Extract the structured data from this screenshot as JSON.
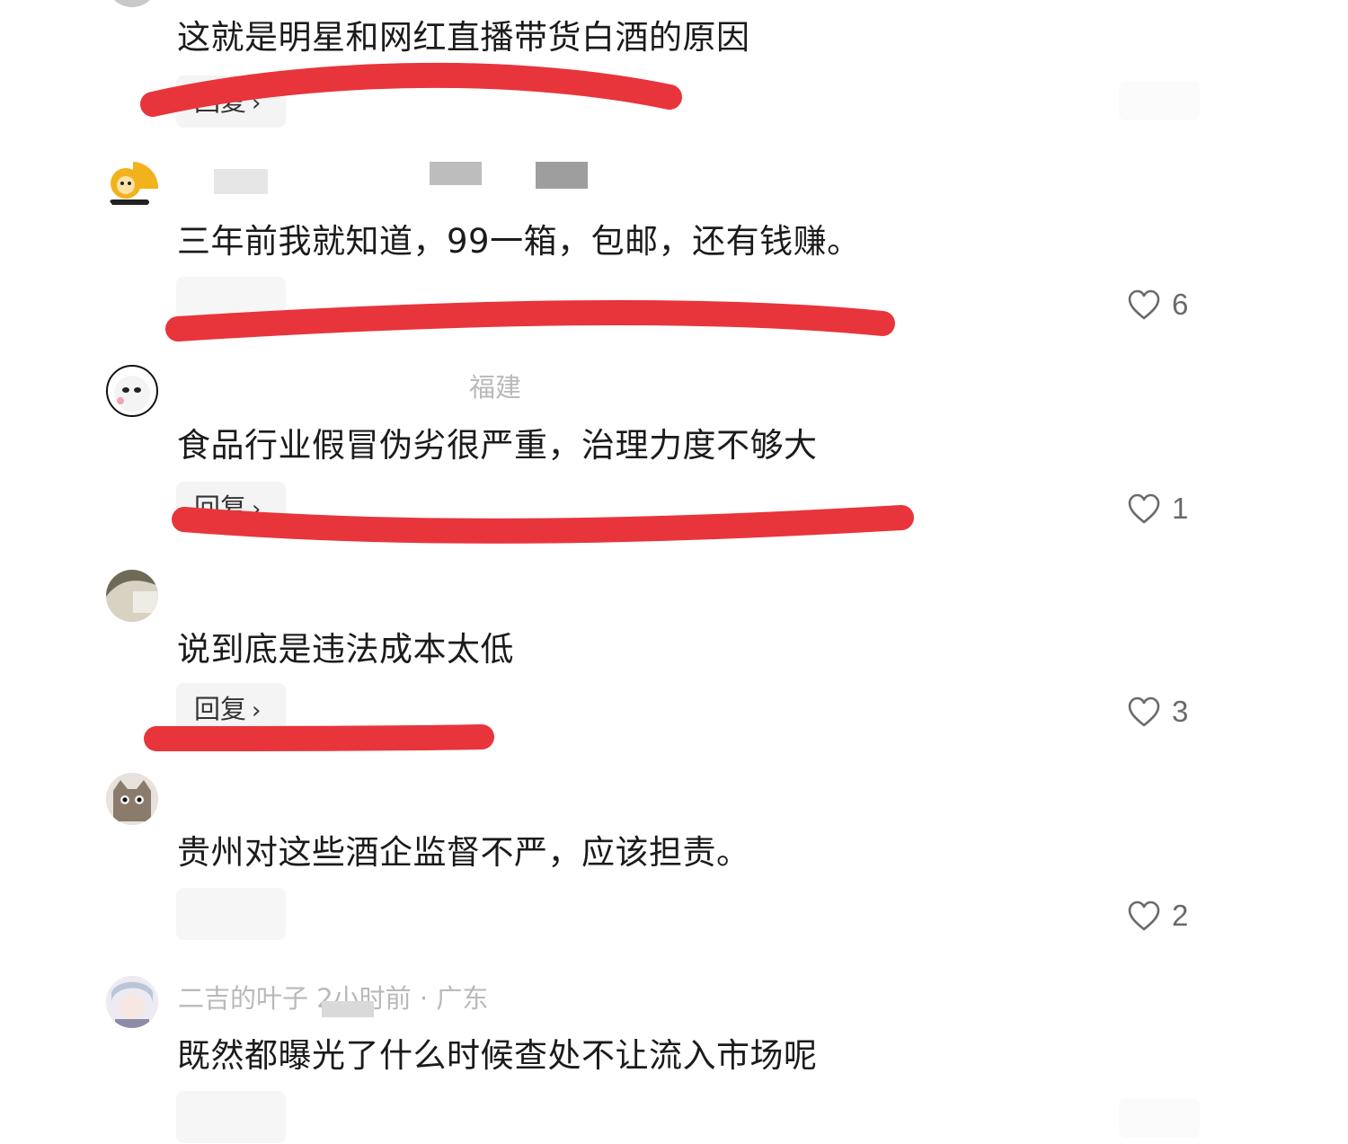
{
  "comments": [
    {
      "text": "这就是明星和网红直播带货白酒的原因",
      "reply_label": "回复",
      "reply_chevron": "›",
      "like_count": ""
    },
    {
      "text": "三年前我就知道，99一箱，包邮，还有钱赚。",
      "reply_label": "",
      "reply_chevron": "",
      "like_count": "6"
    },
    {
      "meta": "福建",
      "text": "食品行业假冒伪劣很严重，治理力度不够大",
      "reply_label": "回复",
      "reply_chevron": "›",
      "like_count": "1"
    },
    {
      "text": "说到底是违法成本太低",
      "reply_label": "回复",
      "reply_chevron": "›",
      "like_count": "3"
    },
    {
      "text": "贵州对这些酒企监督不严，应该担责。",
      "reply_label": "",
      "reply_chevron": "",
      "like_count": "2"
    },
    {
      "meta": "二吉的叶子  2小时前 · 广东",
      "text": "既然都曝光了什么时候查处不让流入市场呢",
      "reply_label": "",
      "reply_chevron": "",
      "like_count": ""
    }
  ],
  "icons": {
    "like": "heart-outline-icon"
  },
  "colors": {
    "annotation_red": "#e8353b",
    "like_icon": "#6a6a6a",
    "meta_text": "#b9b9b9"
  }
}
